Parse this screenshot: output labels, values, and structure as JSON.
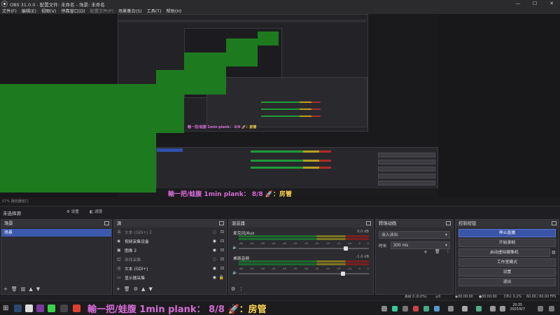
{
  "window": {
    "title": "OBS 31.0.0 - 配置文件: 未命名 - 场景: 未命名",
    "min": "—",
    "max": "☐",
    "close": "✕"
  },
  "menu": [
    "文件(F)",
    "编辑(E)",
    "视图(V)",
    "停靠窗口(D)",
    "配置文件(P)",
    "场景集合(S)",
    "工具(T)",
    "帮助(H)"
  ],
  "overlay": {
    "part1": "輸一把/蛙腹",
    "part2": " 1min plank： 8/8",
    "rocket": "🚀",
    "part3": "：房管"
  },
  "status_line": "57%   播放器窗口",
  "scene_bar": {
    "name": "未选择源",
    "props": "设置",
    "filters": "滤镜"
  },
  "scenes": {
    "title": "场景",
    "items": [
      "场景"
    ]
  },
  "sources": {
    "title": "源",
    "items": [
      {
        "icon": "Ⓐ",
        "name": "文本 (GDI+) 2",
        "dim": true
      },
      {
        "icon": "◉",
        "name": "视频采集设备",
        "dim": false
      },
      {
        "icon": "▣",
        "name": "图像 2",
        "dim": false
      },
      {
        "icon": "◫",
        "name": "游戏采集",
        "dim": true
      },
      {
        "icon": "Ⓐ",
        "name": "文本 (GDI+)",
        "dim": false
      },
      {
        "icon": "▭",
        "name": "显示器采集",
        "dim": false
      }
    ]
  },
  "mixer": {
    "title": "混音器",
    "channels": [
      {
        "name": "麦克风/Aux",
        "db": "0.0 dB"
      },
      {
        "name": "桌面音频",
        "db": "-1.0 dB"
      }
    ],
    "ticks": [
      "-60",
      "-55",
      "-50",
      "-45",
      "-40",
      "-35",
      "-30",
      "-25",
      "-20",
      "-15",
      "-10",
      "-5",
      "0"
    ]
  },
  "transitions": {
    "title": "转场动画",
    "selected": "淡入淡出",
    "duration_label": "时长",
    "duration_value": "300 ms"
  },
  "controls": {
    "title": "控制按钮",
    "stop_stream": "停止直播",
    "start_record": "开始录制",
    "virtual_cam": "启动虚拟摄像机",
    "studio_mode": "工作室模式",
    "settings": "设置",
    "exit": "退出"
  },
  "statusbar": {
    "frames": "丢帧 0 (0.0%)",
    "kbps": "0 kbps",
    "stream_time": "00:00:00",
    "rec_time": "00:00:00",
    "cpu": "CPU: 0.2%",
    "fps": "60.00 / 60.00 FPS"
  },
  "clock": {
    "time": "20:35",
    "date": "2025/9/7"
  }
}
